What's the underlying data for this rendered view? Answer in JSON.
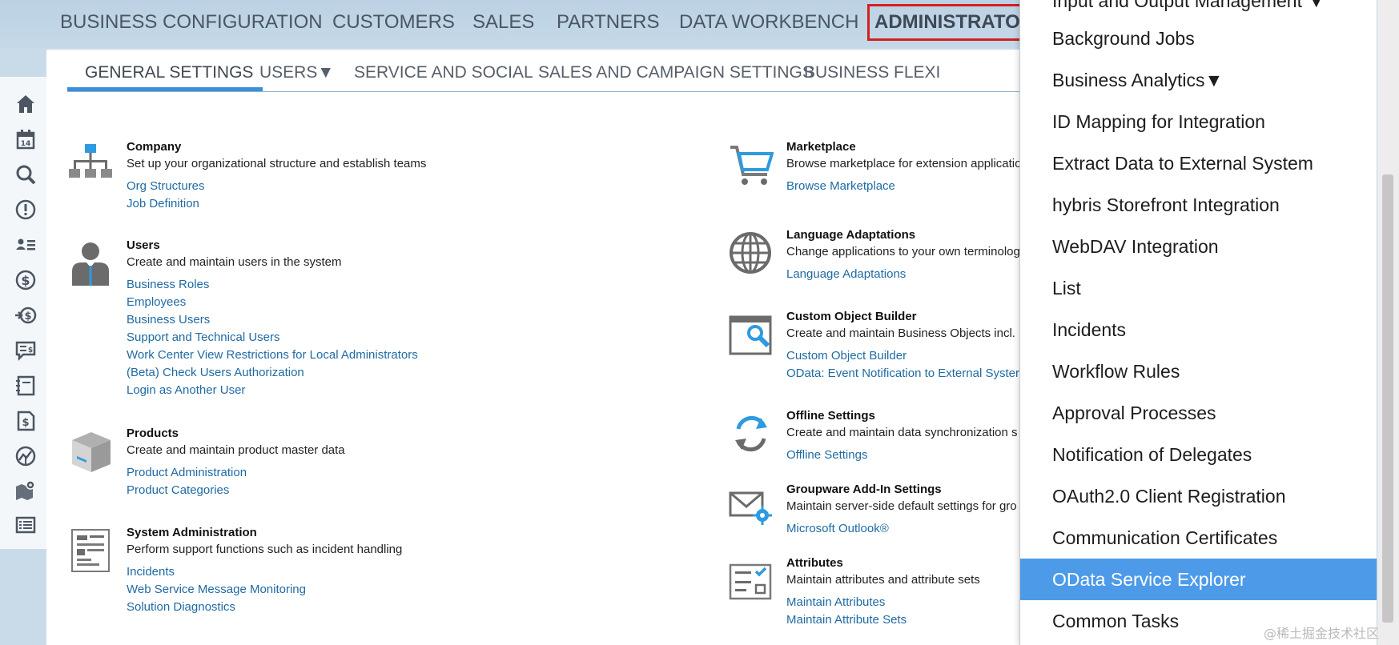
{
  "top_nav": {
    "items": [
      {
        "label": "BUSINESS CONFIGURATION"
      },
      {
        "label": "CUSTOMERS"
      },
      {
        "label": "SALES"
      },
      {
        "label": "PARTNERS"
      },
      {
        "label": "DATA WORKBENCH"
      },
      {
        "label": "ADMINISTRATOR",
        "active": true
      }
    ]
  },
  "sub_tabs": {
    "items": [
      {
        "label": "GENERAL SETTINGS",
        "active": true
      },
      {
        "label": "USERS▼"
      },
      {
        "label": "SERVICE AND SOCIAL"
      },
      {
        "label": "SALES AND CAMPAIGN SETTINGS"
      },
      {
        "label": "BUSINESS FLEXI"
      }
    ]
  },
  "left_rail": {
    "icons": [
      "home-icon",
      "calendar-icon",
      "search-icon",
      "alert-icon",
      "people-list-icon",
      "dollar-icon",
      "transfer-dollar-icon",
      "chat-dollar-icon",
      "notebook-icon",
      "document-dollar-icon",
      "analytics-icon",
      "map-pin-icon",
      "list-icon"
    ]
  },
  "sections_left": [
    {
      "title": "Company",
      "description": "Set up your organizational structure and establish teams",
      "icon": "org-chart-icon",
      "links": [
        "Org Structures",
        "Job Definition"
      ]
    },
    {
      "title": "Users",
      "description": "Create and maintain users in the system",
      "icon": "user-icon",
      "links": [
        "Business Roles",
        "Employees",
        "Business Users",
        "Support and Technical Users",
        "Work Center View Restrictions for Local Administrators",
        "(Beta) Check Users Authorization",
        "Login as Another User"
      ]
    },
    {
      "title": "Products",
      "description": "Create and maintain product master data",
      "icon": "product-box-icon",
      "links": [
        "Product Administration",
        "Product Categories"
      ]
    },
    {
      "title": "System Administration",
      "description": "Perform support functions such as incident handling",
      "icon": "system-admin-icon",
      "links": [
        "Incidents",
        "Web Service Message Monitoring",
        "Solution Diagnostics"
      ]
    }
  ],
  "sections_right": [
    {
      "title": "Marketplace",
      "description": "Browse marketplace for extension applicatio",
      "icon": "shopping-cart-icon",
      "links": [
        "Browse Marketplace"
      ]
    },
    {
      "title": "Language Adaptations",
      "description": "Change applications to your own terminolog",
      "icon": "globe-icon",
      "links": [
        "Language Adaptations"
      ]
    },
    {
      "title": "Custom Object Builder",
      "description": "Create and maintain Business Objects incl.",
      "icon": "object-builder-icon",
      "links": [
        "Custom Object Builder",
        "OData: Event Notification to External Syster"
      ]
    },
    {
      "title": "Offline Settings",
      "description": "Create and maintain data synchronization s",
      "icon": "sync-icon",
      "links": [
        "Offline Settings"
      ]
    },
    {
      "title": "Groupware Add-In Settings",
      "description": "Maintain server-side default settings for gro",
      "icon": "mail-settings-icon",
      "links": [
        "Microsoft Outlook®"
      ]
    },
    {
      "title": "Attributes",
      "description": "Maintain attributes and attribute sets",
      "icon": "attributes-icon",
      "links": [
        "Maintain Attributes",
        "Maintain Attribute Sets"
      ]
    }
  ],
  "dropdown": {
    "items": [
      {
        "label": "Input and Output Management ▼"
      },
      {
        "label": "Background Jobs"
      },
      {
        "label": "Business Analytics▼"
      },
      {
        "label": "ID Mapping for Integration"
      },
      {
        "label": "Extract Data to External System"
      },
      {
        "label": "hybris Storefront Integration"
      },
      {
        "label": "WebDAV Integration"
      },
      {
        "label": "List"
      },
      {
        "label": "Incidents"
      },
      {
        "label": "Workflow Rules"
      },
      {
        "label": "Approval Processes"
      },
      {
        "label": "Notification of Delegates"
      },
      {
        "label": "OAuth2.0 Client Registration"
      },
      {
        "label": "Communication Certificates"
      },
      {
        "label": "OData Service Explorer",
        "selected": true
      },
      {
        "label": "Common Tasks"
      }
    ]
  },
  "watermark": "@稀土掘金技术社区",
  "colors": {
    "accent": "#3a8fd6",
    "link": "#1f6aa3",
    "selected": "#4d9be8",
    "active_outline": "#d0211f",
    "icon_blue": "#2e9be0"
  }
}
